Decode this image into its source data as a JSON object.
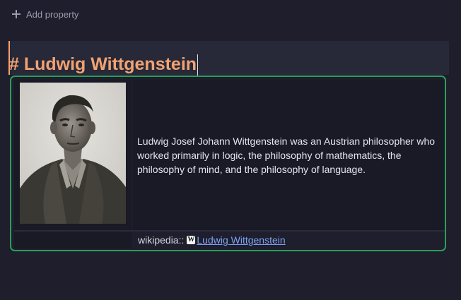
{
  "properties": {
    "add_label": "Add property"
  },
  "block": {
    "heading": "# Ludwig Wittgenstein"
  },
  "card": {
    "description": "Ludwig Josef Johann Wittgenstein was an Austrian philosopher who worked primarily in logic, the philosophy of mathematics, the philosophy of mind, and the philosophy of language.",
    "wiki_key": "wikipedia::",
    "wiki_link_text": "Ludwig Wittgenstein",
    "wiki_icon_glyph": "W"
  },
  "colors": {
    "background": "#1e1e2c",
    "heading": "#f2a271",
    "card_border": "#2aa05a",
    "link": "#7ea2f5"
  },
  "icons": {
    "add": "plus-icon",
    "wiki": "wikipedia-icon"
  }
}
